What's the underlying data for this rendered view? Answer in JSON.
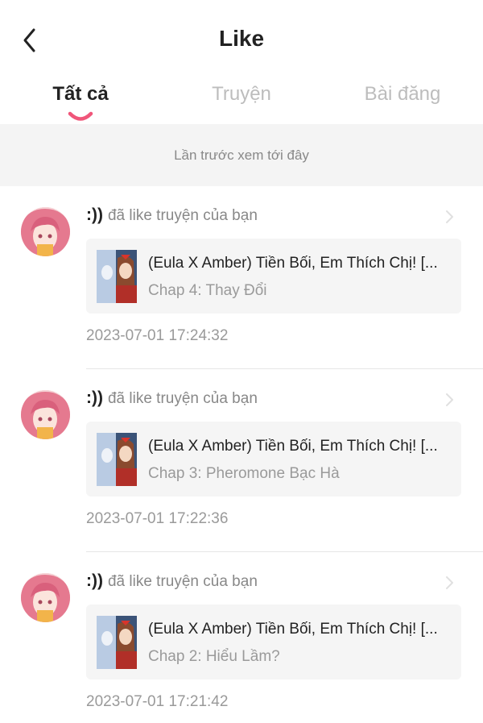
{
  "header": {
    "title": "Like",
    "back_icon": "chevron-left-icon"
  },
  "tabs": [
    {
      "label": "Tất cả",
      "active": true
    },
    {
      "label": "Truyện",
      "active": false
    },
    {
      "label": "Bài đăng",
      "active": false
    }
  ],
  "colors": {
    "accent": "#f0567a",
    "muted": "#9a9a9a",
    "banner_bg": "#f4f4f4",
    "card_bg": "#f5f5f5"
  },
  "banner": {
    "text": "Lần trước xem tới đây"
  },
  "feed": {
    "items": [
      {
        "user": ":))",
        "action": "đã like truyện của bạn",
        "story_title": "(Eula X Amber) Tiền Bối, Em Thích Chị! [...",
        "chapter": "Chap 4: Thay Đổi",
        "time": "2023-07-01 17:24:32"
      },
      {
        "user": ":))",
        "action": "đã like truyện của bạn",
        "story_title": "(Eula X Amber) Tiền Bối, Em Thích Chị! [...",
        "chapter": "Chap 3: Pheromone Bạc Hà",
        "time": "2023-07-01 17:22:36"
      },
      {
        "user": ":))",
        "action": "đã like truyện của bạn",
        "story_title": "(Eula X Amber) Tiền Bối, Em Thích Chị! [...",
        "chapter": "Chap 2: Hiểu Lầm?",
        "time": "2023-07-01 17:21:42"
      }
    ]
  }
}
